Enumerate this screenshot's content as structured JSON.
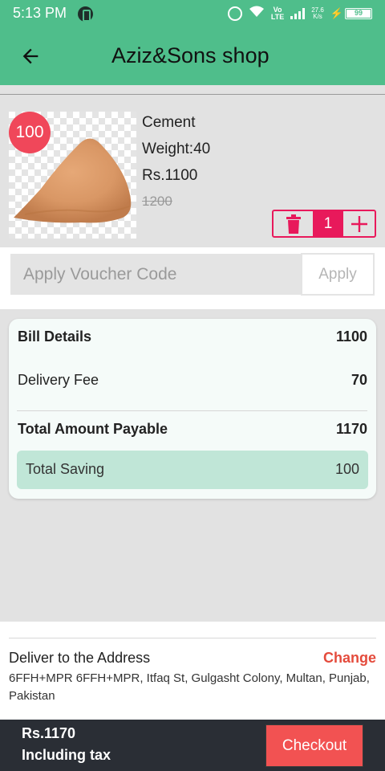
{
  "status_bar": {
    "time": "5:13 PM",
    "volte_top": "Vo",
    "volte_bottom": "LTE",
    "speed_top": "27.6",
    "speed_bottom": "K/s",
    "battery": "99"
  },
  "app_bar": {
    "title": "Aziz&Sons shop"
  },
  "product": {
    "discount": "100",
    "name": "Cement",
    "weight": "Weight:40",
    "price": "Rs.1100",
    "old_price": "1200",
    "quantity": "1"
  },
  "voucher": {
    "placeholder": "Apply Voucher Code",
    "apply_label": "Apply"
  },
  "bill": {
    "rows": [
      {
        "label": "Bill Details",
        "value": "1100"
      },
      {
        "label": "Delivery Fee",
        "value": "70"
      },
      {
        "label": "Total Amount Payable",
        "value": "1170"
      }
    ],
    "saving_label": "Total Saving",
    "saving_value": "100"
  },
  "address": {
    "heading": "Deliver to the Address",
    "change_label": "Change",
    "text": "6FFH+MPR 6FFH+MPR, Itfaq St, Gulgasht Colony, Multan, Punjab, Pakistan"
  },
  "bottom_bar": {
    "total": "Rs.1170",
    "tax_note": "Including tax",
    "checkout_label": "Checkout"
  },
  "colors": {
    "primary": "#4fbe8b",
    "accent": "#e8195b",
    "badge": "#f0475a",
    "checkout": "#f25252",
    "change": "#e44b3c",
    "bottom_bar": "#2a2e35"
  }
}
